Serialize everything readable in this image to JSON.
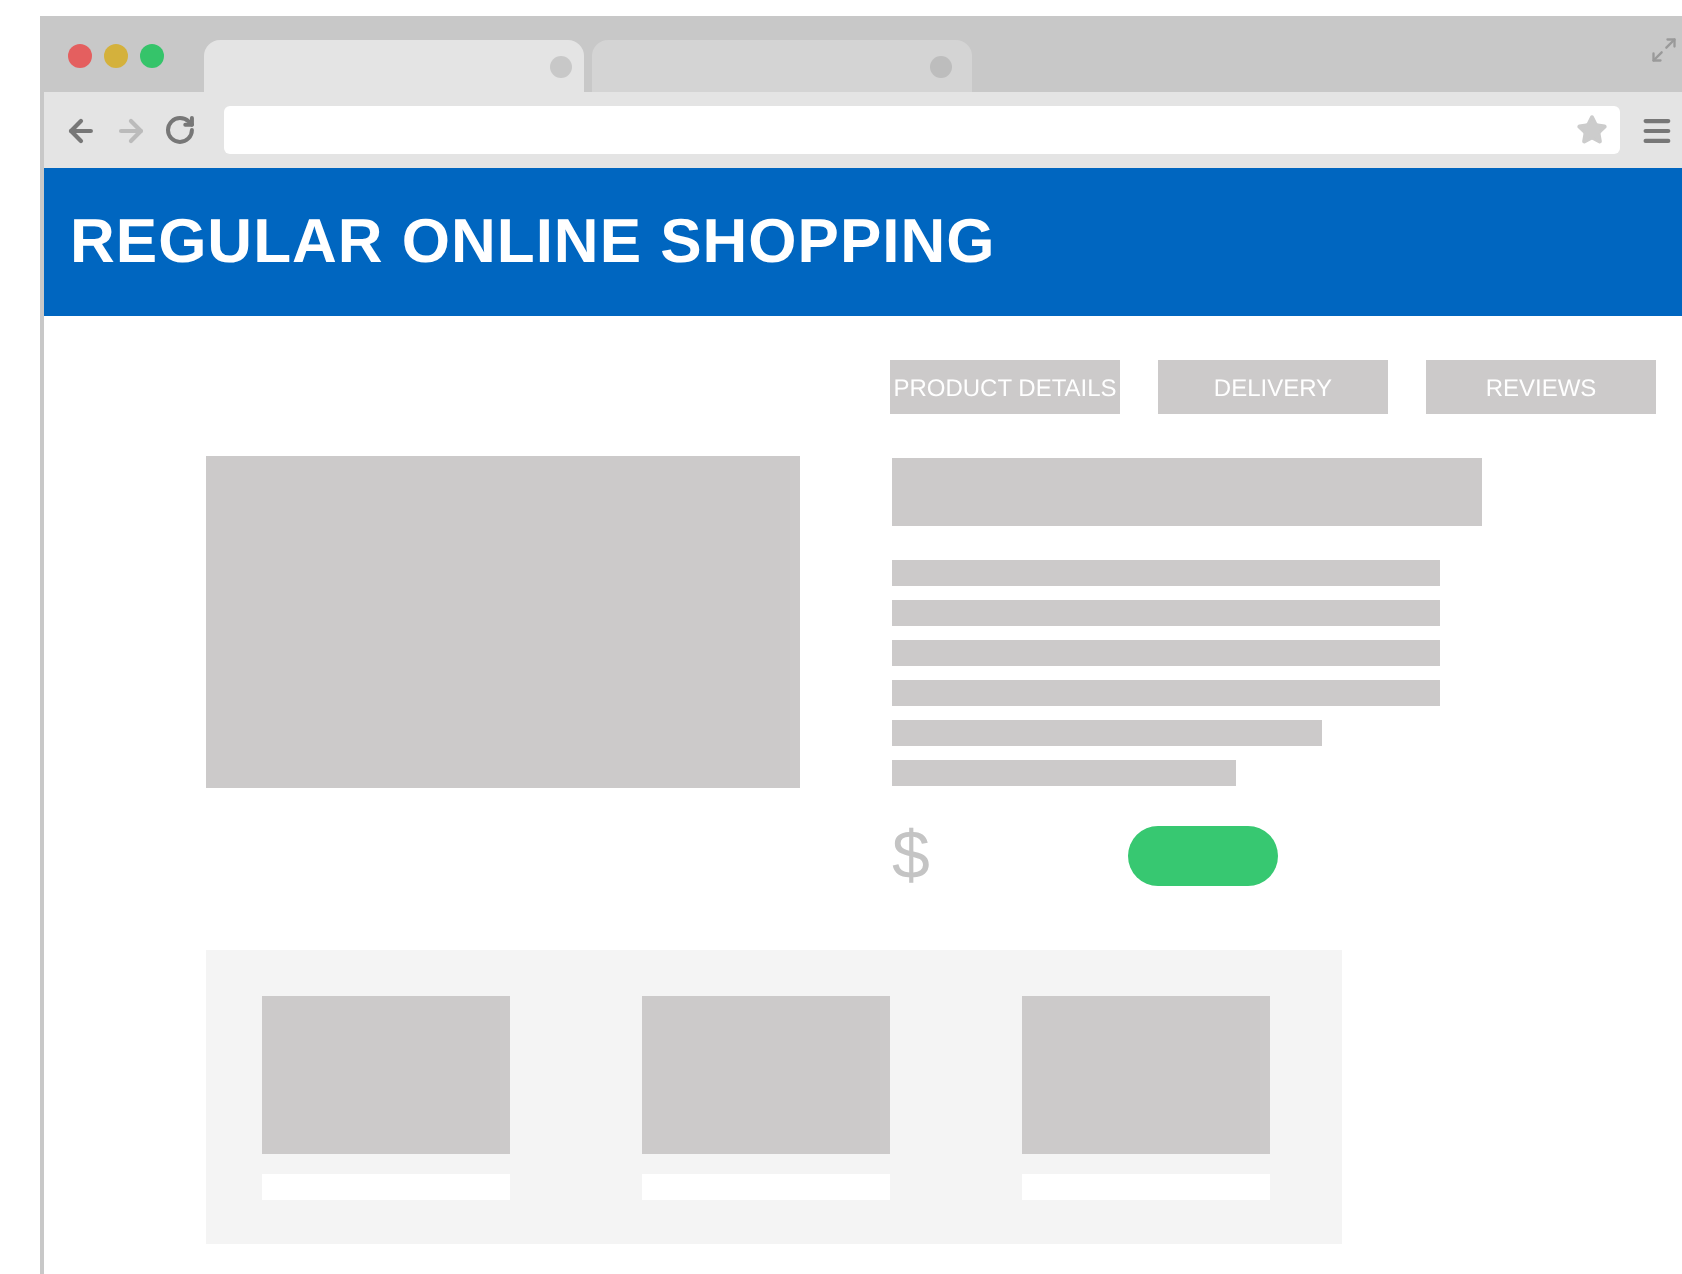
{
  "banner": {
    "title": "REGULAR ONLINE SHOPPING"
  },
  "tabs": [
    {
      "label": "PRODUCT DETAILS"
    },
    {
      "label": "DELIVERY"
    },
    {
      "label": "REVIEWS"
    }
  ],
  "price": {
    "symbol": "$"
  }
}
